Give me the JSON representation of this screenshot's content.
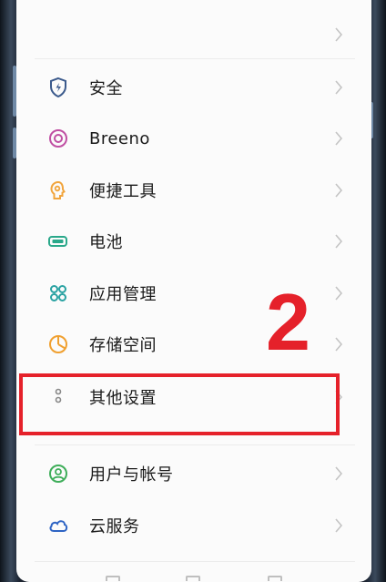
{
  "settings": {
    "items": [
      {
        "label": "",
        "icon": "none"
      },
      {
        "label": "安全",
        "icon": "shield-icon",
        "color": "#3b5a8c"
      },
      {
        "label": "Breeno",
        "icon": "breeno-icon",
        "color": "#c04fa3"
      },
      {
        "label": "便捷工具",
        "icon": "tools-icon",
        "color": "#f1a43c"
      },
      {
        "label": "电池",
        "icon": "battery-icon",
        "color": "#2aa88a"
      },
      {
        "label": "应用管理",
        "icon": "apps-icon",
        "color": "#2aa2a2"
      },
      {
        "label": "存储空间",
        "icon": "storage-icon",
        "color": "#f0a030"
      },
      {
        "label": "其他设置",
        "icon": "more-settings-icon",
        "color": "#888888"
      },
      {
        "label": "用户与帐号",
        "icon": "user-icon",
        "color": "#3fae5a"
      },
      {
        "label": "云服务",
        "icon": "cloud-icon",
        "color": "#2e64c4"
      }
    ]
  },
  "annotation": {
    "step_number": "2",
    "color": "#e5212a"
  }
}
